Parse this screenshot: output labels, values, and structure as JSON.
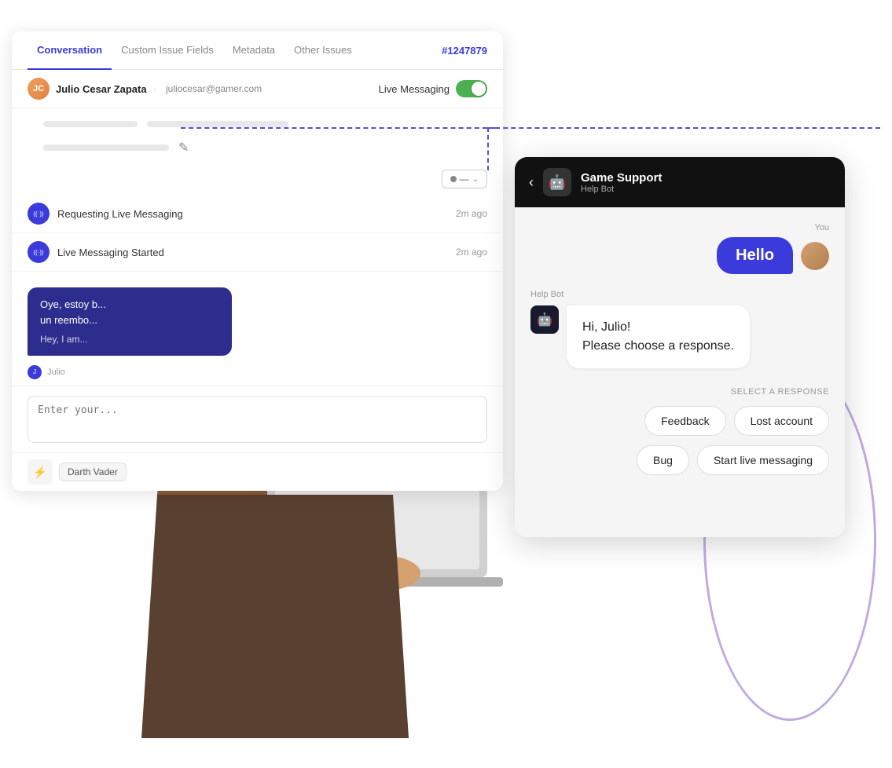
{
  "left_panel": {
    "tabs": [
      {
        "id": "conversation",
        "label": "Conversation",
        "active": true
      },
      {
        "id": "custom-issue-fields",
        "label": "Custom Issue Fields",
        "active": false
      },
      {
        "id": "metadata",
        "label": "Metadata",
        "active": false
      },
      {
        "id": "other-issues",
        "label": "Other Issues",
        "active": false
      }
    ],
    "issue_number": "#1247879",
    "user": {
      "name": "Julio Cesar Zapata",
      "email": "juliocesar@gamer.com",
      "initials": "JC"
    },
    "live_messaging": {
      "label": "Live Messaging",
      "enabled": true
    },
    "activities": [
      {
        "icon": "((·))",
        "text": "Requesting Live Messaging",
        "time": "2m ago"
      },
      {
        "icon": "((·))",
        "text": "Live Messaging Started",
        "time": "2m ago"
      }
    ],
    "chat_message": {
      "text": "Oye, estoy b...\nun reembo...",
      "translation": "Hey, I am...",
      "sender": "Julio"
    },
    "input_placeholder": "Enter your...",
    "bottom_label": "Darth Vader"
  },
  "right_panel": {
    "header": {
      "title": "Game Support",
      "subtitle": "Help Bot"
    },
    "you_label": "You",
    "hello_bubble": "Hello",
    "help_bot_label": "Help Bot",
    "bot_message": "Hi, Julio!\nPlease choose a response.",
    "select_label": "SELECT A RESPONSE",
    "response_options": [
      {
        "id": "feedback",
        "label": "Feedback"
      },
      {
        "id": "lost-account",
        "label": "Lost account"
      },
      {
        "id": "bug",
        "label": "Bug"
      },
      {
        "id": "start-live-messaging",
        "label": "Start live messaging"
      }
    ]
  },
  "icons": {
    "back": "‹",
    "bot": "🤖",
    "edit": "✎",
    "chevron_down": "⌄",
    "lightning": "⚡"
  }
}
